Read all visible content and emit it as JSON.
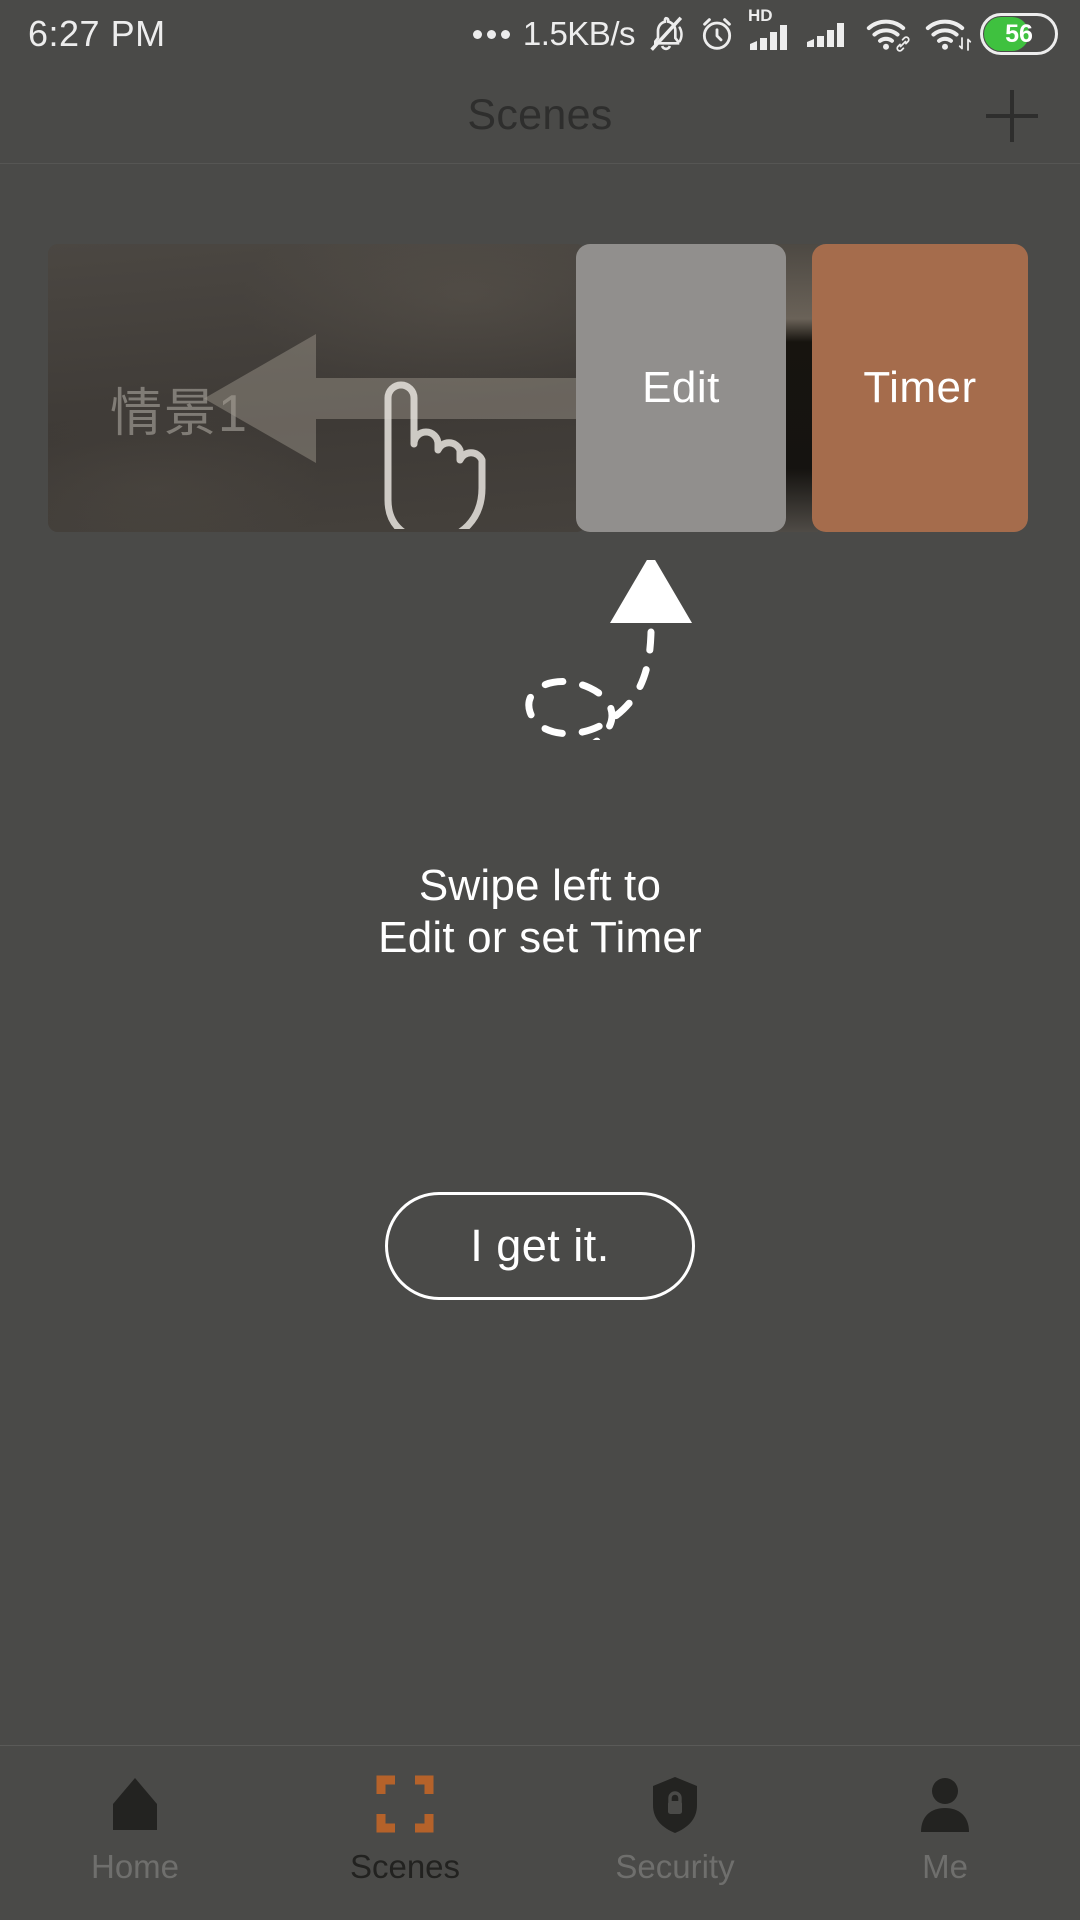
{
  "status_bar": {
    "time": "6:27 PM",
    "network_speed": "1.5KB/s",
    "battery_level": "56",
    "icons": [
      "more-dots-icon",
      "mute-bell-icon",
      "alarm-clock-icon",
      "hd-signal-icon",
      "signal-icon",
      "wifi-link-icon",
      "wifi-transfer-icon",
      "battery-icon"
    ]
  },
  "top_bar": {
    "title": "Scenes",
    "add_button": "add-icon"
  },
  "scene_row": {
    "scene_name": "情景1",
    "edit_label": "Edit",
    "timer_label": "Timer",
    "swipe_arrow_icon": "left-arrow-icon",
    "hand_icon": "pointing-hand-icon"
  },
  "coach_mark": {
    "line1": "Swipe left to",
    "line2": "Edit or set Timer",
    "pointer_icon": "curved-dashed-arrow-icon",
    "dismiss_label": "I get it."
  },
  "bottom_nav": {
    "items": [
      {
        "label": "Home",
        "icon": "home-icon",
        "active": false
      },
      {
        "label": "Scenes",
        "icon": "scenes-icon",
        "active": true
      },
      {
        "label": "Security",
        "icon": "shield-lock-icon",
        "active": false
      },
      {
        "label": "Me",
        "icon": "person-icon",
        "active": false
      }
    ]
  },
  "colors": {
    "background": "#4a4a48",
    "edit_button": "#918f8d",
    "timer_button": "#a56c4c",
    "accent_orange": "#b5622a",
    "battery_green": "#3fc13f",
    "text_white": "#ffffff"
  }
}
